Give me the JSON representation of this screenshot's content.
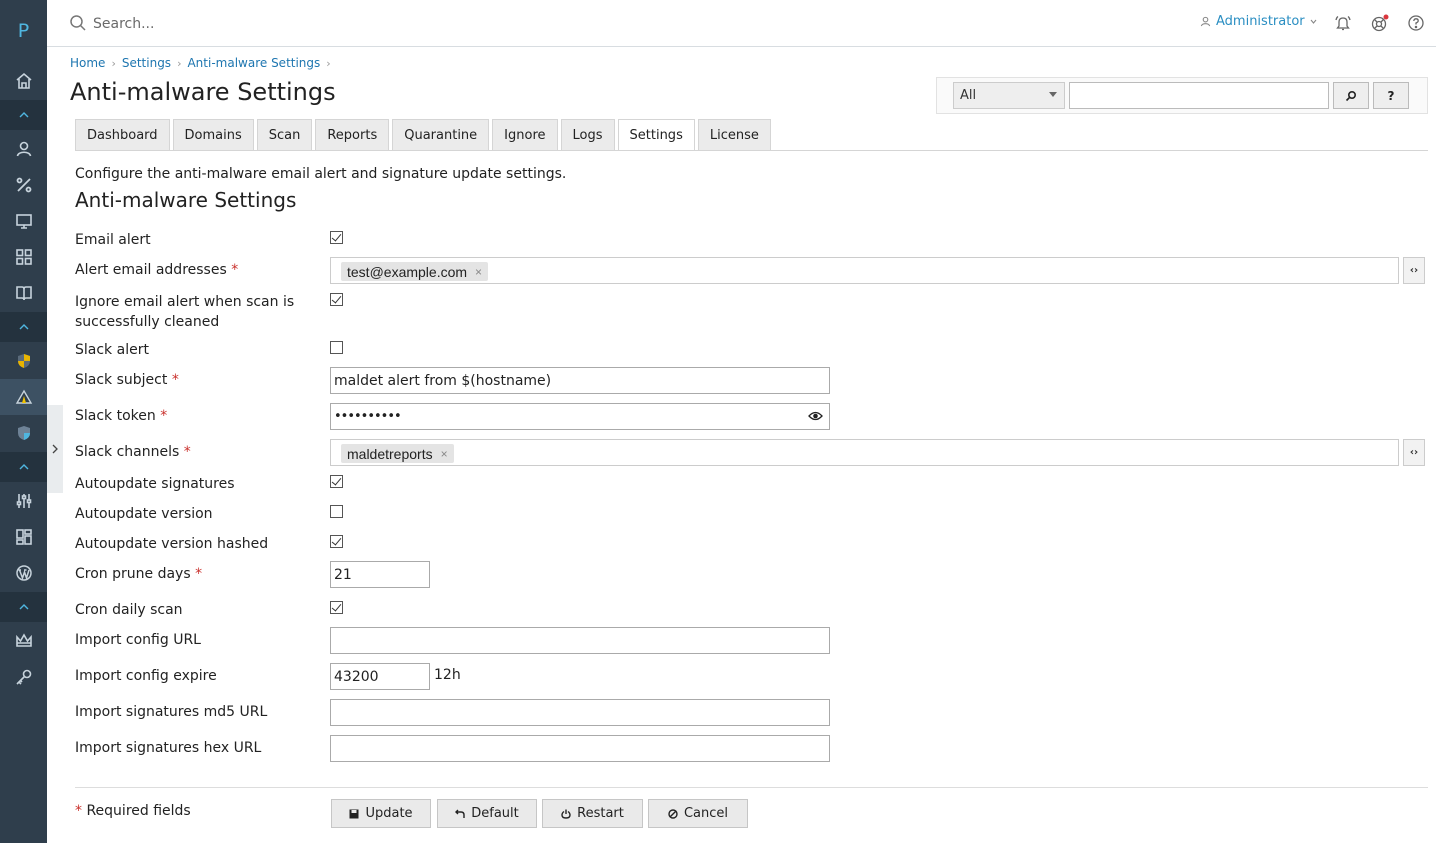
{
  "sidebar": {
    "logo": "P",
    "items": [
      {
        "name": "home-icon"
      },
      {
        "name": "user-icon"
      },
      {
        "name": "percent-icon"
      },
      {
        "name": "monitor-icon"
      },
      {
        "name": "apps-icon"
      },
      {
        "name": "book-icon"
      },
      {
        "name": "shield-yellow-icon"
      },
      {
        "name": "maldet-icon"
      },
      {
        "name": "shield-blue-icon"
      },
      {
        "name": "sliders-icon"
      },
      {
        "name": "layout-icon"
      },
      {
        "name": "wordpress-icon"
      },
      {
        "name": "crown-icon"
      },
      {
        "name": "key-icon"
      }
    ]
  },
  "topbar": {
    "search_placeholder": "Search...",
    "user_label": "Administrator"
  },
  "breadcrumb": [
    "Home",
    "Settings",
    "Anti-malware Settings"
  ],
  "page_title": "Anti-malware Settings",
  "tools": {
    "filter_selected": "All",
    "search_btn": "⌕",
    "help_btn": "?"
  },
  "tabs": [
    "Dashboard",
    "Domains",
    "Scan",
    "Reports",
    "Quarantine",
    "Ignore",
    "Logs",
    "Settings",
    "License"
  ],
  "active_tab": "Settings",
  "description": "Configure the anti-malware email alert and signature update settings.",
  "section_title": "Anti-malware Settings",
  "form": {
    "email_alert": {
      "label": "Email alert",
      "checked": true
    },
    "alert_email_addresses": {
      "label": "Alert email addresses",
      "tag": "test@example.com"
    },
    "ignore_email_alert": {
      "label_line1": "Ignore email alert when scan is",
      "label_line2": "successfully cleaned",
      "checked": true
    },
    "slack_alert": {
      "label": "Slack alert",
      "checked": false
    },
    "slack_subject": {
      "label": "Slack subject",
      "value": "maldet alert from $(hostname)"
    },
    "slack_token": {
      "label": "Slack token",
      "value": "••••••••••"
    },
    "slack_channels": {
      "label": "Slack channels",
      "tag": "maldetreports"
    },
    "autoupdate_signatures": {
      "label": "Autoupdate signatures",
      "checked": true
    },
    "autoupdate_version": {
      "label": "Autoupdate version",
      "checked": false
    },
    "autoupdate_version_hashed": {
      "label": "Autoupdate version hashed",
      "checked": true
    },
    "cron_prune_days": {
      "label": "Cron prune days",
      "value": "21"
    },
    "cron_daily_scan": {
      "label": "Cron daily scan",
      "checked": true
    },
    "import_config_url": {
      "label": "Import config URL",
      "value": ""
    },
    "import_config_expire": {
      "label": "Import config expire",
      "value": "43200",
      "suffix": "12h"
    },
    "import_sig_md5_url": {
      "label": "Import signatures md5 URL",
      "value": ""
    },
    "import_sig_hex_url": {
      "label": "Import signatures hex URL",
      "value": ""
    }
  },
  "required_star": "*",
  "required_note": "Required fields",
  "buttons": {
    "update": "Update",
    "default": "Default",
    "restart": "Restart",
    "cancel": "Cancel"
  },
  "colors": {
    "sidebar_bg": "#2f3e4c",
    "link": "#1e76b0",
    "required": "#c9302c"
  }
}
